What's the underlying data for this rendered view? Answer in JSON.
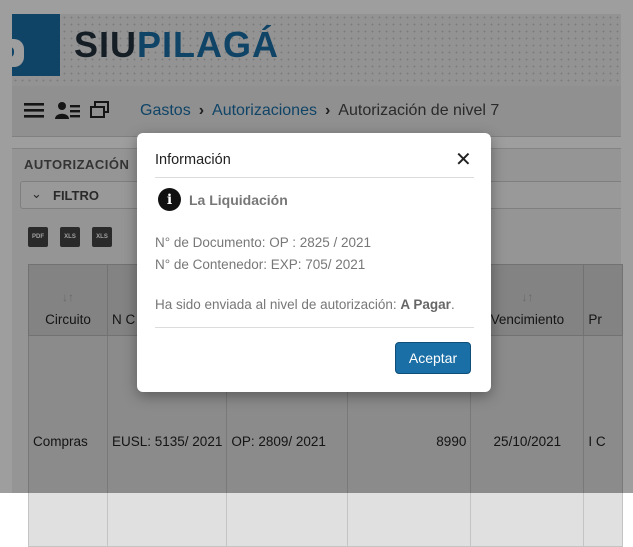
{
  "app": {
    "brand_siu": "SIU",
    "brand_pilaga": "PILAGÁ"
  },
  "nav": {
    "icons": [
      "menu-icon",
      "users-icon",
      "windows-icon"
    ],
    "breadcrumb": [
      {
        "label": "Gastos",
        "link": true
      },
      {
        "label": "Autorizaciones",
        "link": true
      },
      {
        "label": "Autorización de nivel 7",
        "link": false
      }
    ],
    "separator": "›"
  },
  "panel": {
    "title": "AUTORIZACIÓN",
    "filter_label": "FILTRO",
    "export_buttons": [
      {
        "icon": "pdf-export-icon",
        "text": "PDF"
      },
      {
        "icon": "xls-export-icon",
        "text": "XLS"
      },
      {
        "icon": "xls-export-icon",
        "text": "XLS"
      }
    ]
  },
  "table": {
    "headers": [
      "Circuito",
      "N C",
      "",
      "",
      "Vencimiento",
      "Pr"
    ],
    "rows": [
      [
        "Compras",
        "EUSL: 5135/ 2021",
        "OP: 2809/ 2021",
        "8990",
        "25/10/2021",
        "I C"
      ]
    ]
  },
  "modal": {
    "title": "Información",
    "close_symbol": "✕",
    "info_label": "La Liquidación",
    "documento": "N° de Documento: OP : 2825 / 2021",
    "contenedor": "N° de Contenedor: EXP: 705/ 2021",
    "message_prefix": "Ha sido enviada al nivel de autorización: ",
    "message_level": "A Pagar",
    "message_suffix": ".",
    "button_label": "Aceptar"
  },
  "colors": {
    "accent": "#1a6fa6",
    "dark": "#25313c"
  }
}
